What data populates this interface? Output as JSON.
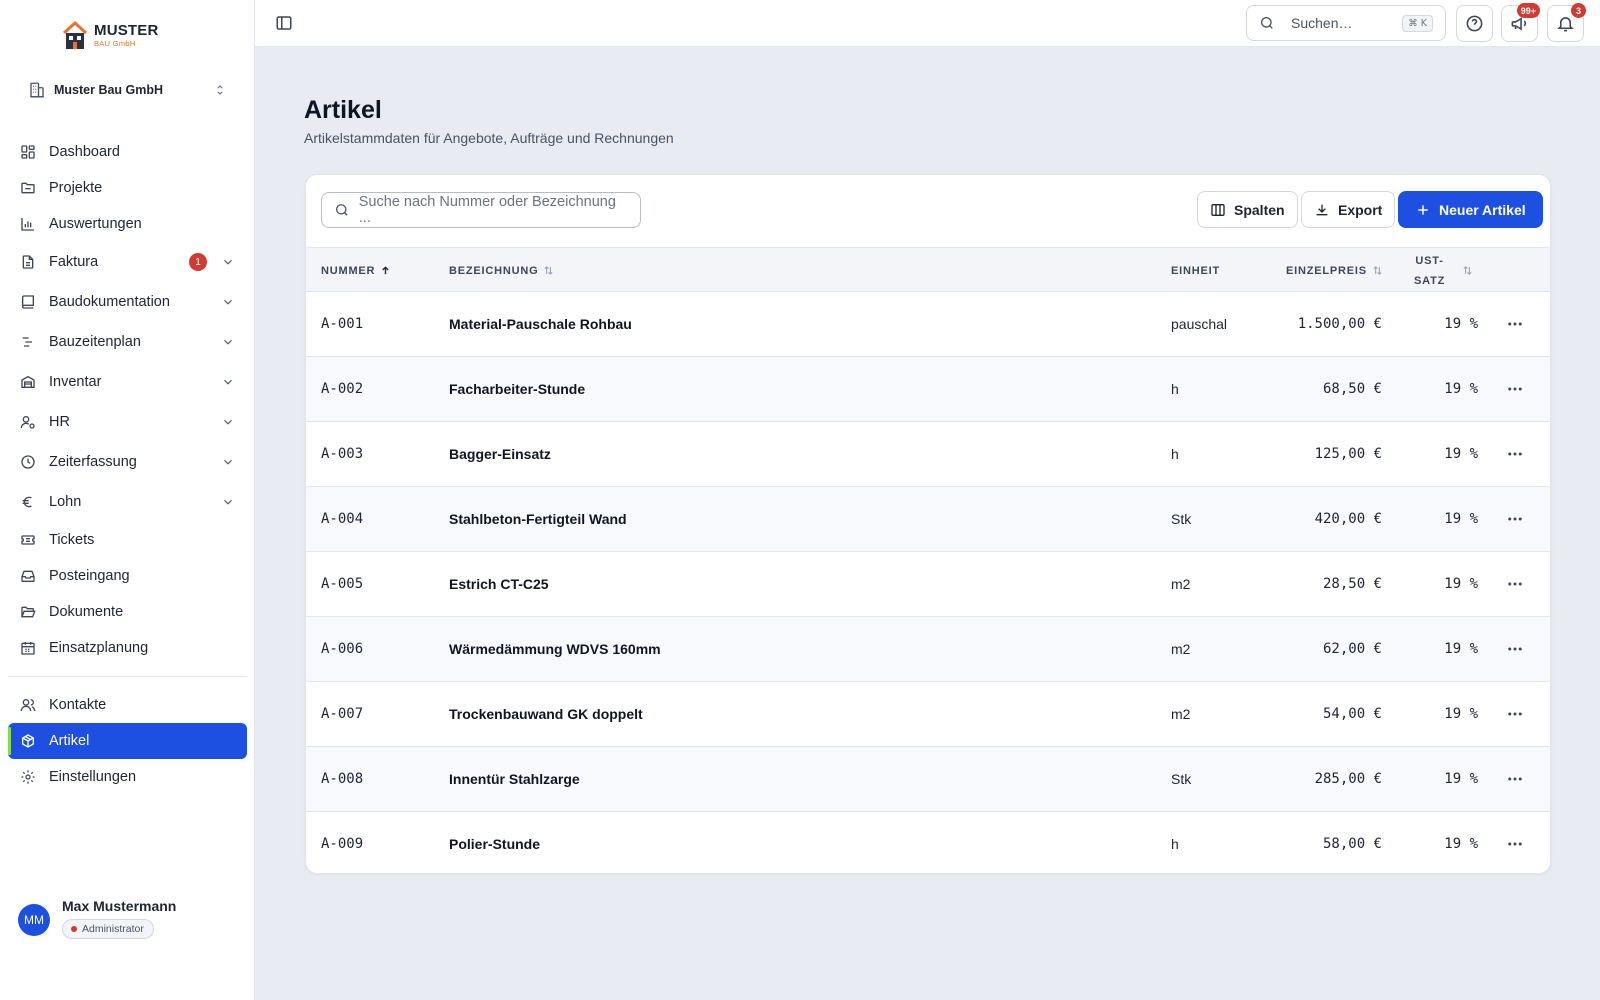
{
  "logo": {
    "title": "MUSTER",
    "subtitle": "BAU GmbH"
  },
  "company": {
    "name": "Muster Bau GmbH"
  },
  "nav": [
    {
      "label": "Dashboard",
      "icon": "dashboard-icon"
    },
    {
      "label": "Projekte",
      "icon": "folder-icon"
    },
    {
      "label": "Auswertungen",
      "icon": "bar-chart-icon"
    },
    {
      "label": "Faktura",
      "icon": "document-icon",
      "badge": "1",
      "expandable": true
    },
    {
      "label": "Baudokumentation",
      "icon": "book-icon",
      "expandable": true
    },
    {
      "label": "Bauzeitenplan",
      "icon": "gantt-icon",
      "expandable": true
    },
    {
      "label": "Inventar",
      "icon": "inventory-icon",
      "expandable": true
    },
    {
      "label": "HR",
      "icon": "user-cog-icon",
      "expandable": true
    },
    {
      "label": "Zeiterfassung",
      "icon": "clock-icon",
      "expandable": true
    },
    {
      "label": "Lohn",
      "icon": "euro-icon",
      "expandable": true
    },
    {
      "label": "Tickets",
      "icon": "ticket-icon"
    },
    {
      "label": "Posteingang",
      "icon": "inbox-icon"
    },
    {
      "label": "Dokumente",
      "icon": "folder-open-icon"
    },
    {
      "label": "Einsatzplanung",
      "icon": "calendar-icon"
    }
  ],
  "nav_bottom": [
    {
      "label": "Kontakte",
      "icon": "users-icon"
    },
    {
      "label": "Artikel",
      "icon": "package-icon",
      "active": true
    },
    {
      "label": "Einstellungen",
      "icon": "settings-icon"
    }
  ],
  "user": {
    "initials": "MM",
    "name": "Max Mustermann",
    "role": "Administrator"
  },
  "topbar": {
    "search_placeholder": "Suchen…",
    "shortcut": "⌘ K",
    "announcements_badge": "99+",
    "notifications_badge": "3"
  },
  "page": {
    "title": "Artikel",
    "subtitle": "Artikelstammdaten für Angebote, Aufträge und Rechnungen"
  },
  "toolbar": {
    "search_placeholder": "Suche nach Nummer oder Bezeichnung ...",
    "columns_label": "Spalten",
    "export_label": "Export",
    "new_label": "Neuer Artikel"
  },
  "table": {
    "headers": {
      "nummer": "NUMMER",
      "bezeichnung": "BEZEICHNUNG",
      "einheit": "EINHEIT",
      "einzelpreis": "EINZELPREIS",
      "ust_line1": "UST-",
      "ust_line2": "SATZ"
    },
    "rows": [
      {
        "nummer": "A-001",
        "bezeichnung": "Material-Pauschale Rohbau",
        "einheit": "pauschal",
        "preis": "1.500,00 €",
        "ust": "19 %"
      },
      {
        "nummer": "A-002",
        "bezeichnung": "Facharbeiter-Stunde",
        "einheit": "h",
        "preis": "68,50 €",
        "ust": "19 %"
      },
      {
        "nummer": "A-003",
        "bezeichnung": "Bagger-Einsatz",
        "einheit": "h",
        "preis": "125,00 €",
        "ust": "19 %"
      },
      {
        "nummer": "A-004",
        "bezeichnung": "Stahlbeton-Fertigteil Wand",
        "einheit": "Stk",
        "preis": "420,00 €",
        "ust": "19 %"
      },
      {
        "nummer": "A-005",
        "bezeichnung": "Estrich CT-C25",
        "einheit": "m2",
        "preis": "28,50 €",
        "ust": "19 %"
      },
      {
        "nummer": "A-006",
        "bezeichnung": "Wärmedämmung WDVS 160mm",
        "einheit": "m2",
        "preis": "62,00 €",
        "ust": "19 %"
      },
      {
        "nummer": "A-007",
        "bezeichnung": "Trockenbauwand GK doppelt",
        "einheit": "m2",
        "preis": "54,00 €",
        "ust": "19 %"
      },
      {
        "nummer": "A-008",
        "bezeichnung": "Innentür Stahlzarge",
        "einheit": "Stk",
        "preis": "285,00 €",
        "ust": "19 %"
      },
      {
        "nummer": "A-009",
        "bezeichnung": "Polier-Stunde",
        "einheit": "h",
        "preis": "58,00 €",
        "ust": "19 %"
      }
    ]
  },
  "colors": {
    "accent": "#1d4fe0",
    "badge": "#d23b31",
    "brand_orange": "#e8732a",
    "active_marker": "#8bdc4b"
  }
}
